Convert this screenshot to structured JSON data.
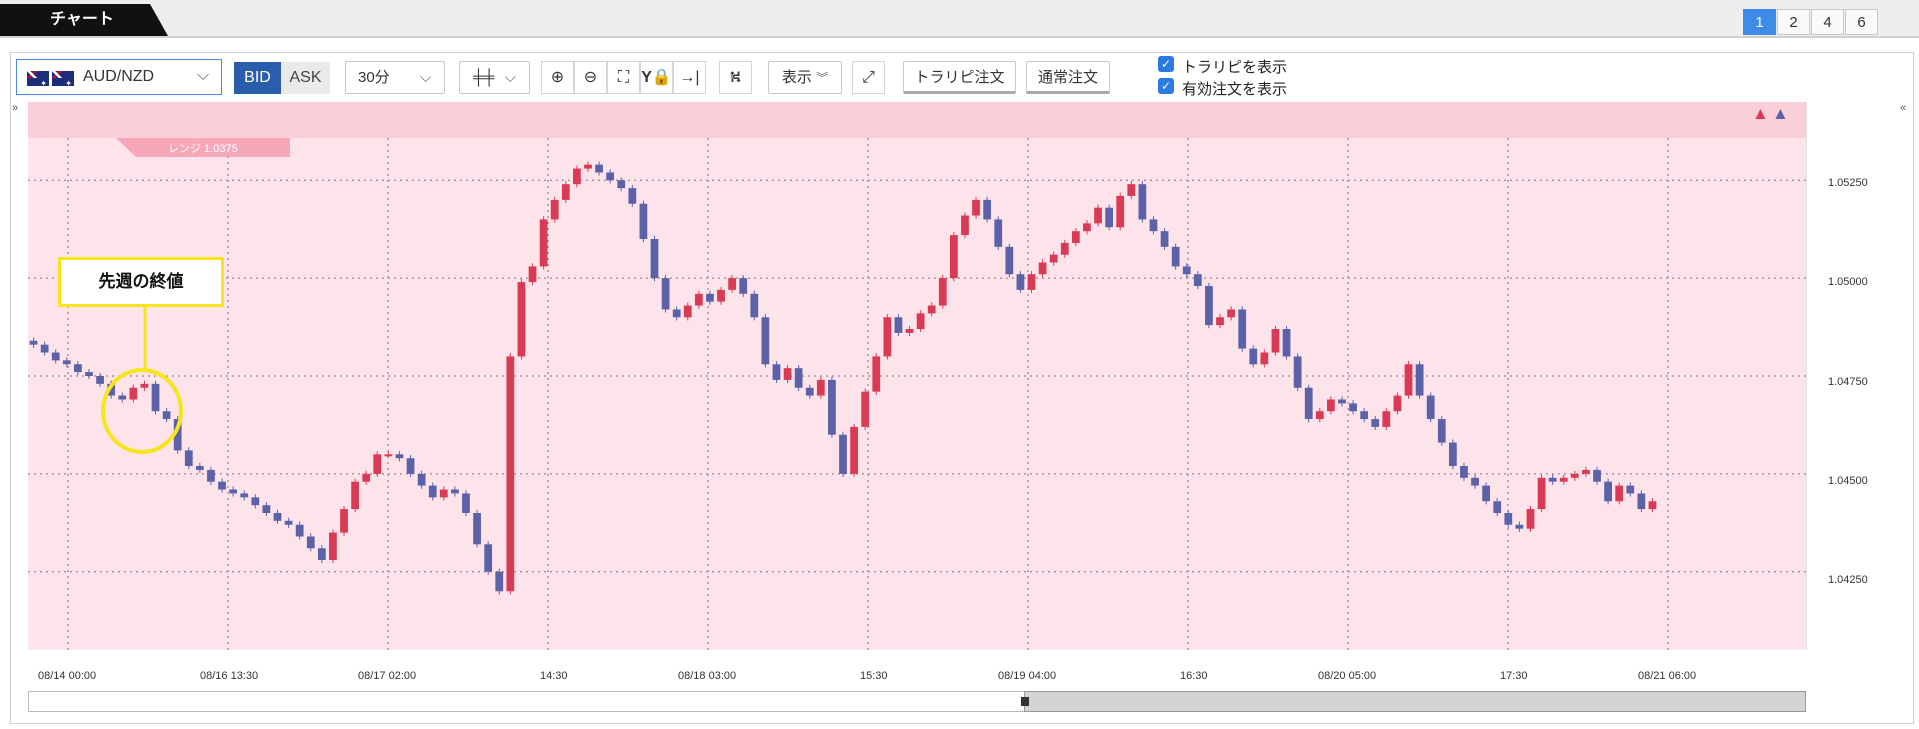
{
  "top": {
    "tab_label": "チャート",
    "layouts": [
      "1",
      "2",
      "4",
      "6"
    ],
    "active_layout": "1"
  },
  "toolbar": {
    "pair": "AUD/NZD",
    "bid": "BID",
    "ask": "ASK",
    "timeframe": "30分",
    "display": "表示",
    "trail_order": "トラリピ注文",
    "normal_order": "通常注文",
    "check_trail": "トラリピを表示",
    "check_orders": "有効注文を表示"
  },
  "chart": {
    "range_label": "レンジ 1.0375",
    "annotation": "先週の終値",
    "y_ticks": [
      "1.05250",
      "1.05000",
      "1.04750",
      "1.04500",
      "1.04250"
    ],
    "x_ticks": [
      "08/14 00:00",
      "08/16 13:30",
      "08/17 02:00",
      "14:30",
      "08/18 03:00",
      "15:30",
      "08/19 04:00",
      "16:30",
      "08/20 05:00",
      "17:30",
      "08/21 06:00"
    ],
    "colors": {
      "up": "#d93a56",
      "down": "#5b62a8",
      "bg": "#fde4ea"
    }
  },
  "chart_data": {
    "type": "candlestick",
    "ylim": [
      1.0405,
      1.0545
    ],
    "closes": [
      1.0483,
      1.0481,
      1.0479,
      1.0478,
      1.0476,
      1.0475,
      1.0473,
      1.047,
      1.0469,
      1.0472,
      1.0473,
      1.0466,
      1.0464,
      1.0456,
      1.0452,
      1.0451,
      1.0448,
      1.0446,
      1.0445,
      1.0444,
      1.0442,
      1.044,
      1.0438,
      1.0437,
      1.0434,
      1.0431,
      1.0428,
      1.0435,
      1.0441,
      1.0448,
      1.045,
      1.0455,
      1.0455,
      1.0454,
      1.045,
      1.0447,
      1.0444,
      1.0446,
      1.0445,
      1.044,
      1.0432,
      1.0425,
      1.042,
      1.048,
      1.0499,
      1.0503,
      1.0515,
      1.052,
      1.0524,
      1.0528,
      1.0529,
      1.0527,
      1.0525,
      1.0523,
      1.0519,
      1.051,
      1.05,
      1.0492,
      1.049,
      1.0493,
      1.0496,
      1.0494,
      1.0497,
      1.05,
      1.0496,
      1.049,
      1.0478,
      1.0474,
      1.0477,
      1.0472,
      1.047,
      1.0474,
      1.046,
      1.045,
      1.0462,
      1.0471,
      1.048,
      1.049,
      1.0486,
      1.0487,
      1.0491,
      1.0493,
      1.05,
      1.0511,
      1.0516,
      1.052,
      1.0515,
      1.0508,
      1.0501,
      1.0497,
      1.0501,
      1.0504,
      1.0506,
      1.0509,
      1.0512,
      1.0514,
      1.0518,
      1.0513,
      1.0521,
      1.0524,
      1.0515,
      1.0512,
      1.0508,
      1.0503,
      1.0501,
      1.0498,
      1.0488,
      1.049,
      1.0492,
      1.0482,
      1.0478,
      1.0481,
      1.0487,
      1.048,
      1.0472,
      1.0464,
      1.0466,
      1.0469,
      1.0468,
      1.0466,
      1.0464,
      1.0462,
      1.0466,
      1.047,
      1.0478,
      1.047,
      1.0464,
      1.0458,
      1.0452,
      1.0449,
      1.0447,
      1.0443,
      1.044,
      1.0437,
      1.0436,
      1.0441,
      1.0449,
      1.0448,
      1.0449,
      1.045,
      1.0451,
      1.0448,
      1.0443,
      1.0447,
      1.0445,
      1.0441,
      1.0443
    ]
  }
}
